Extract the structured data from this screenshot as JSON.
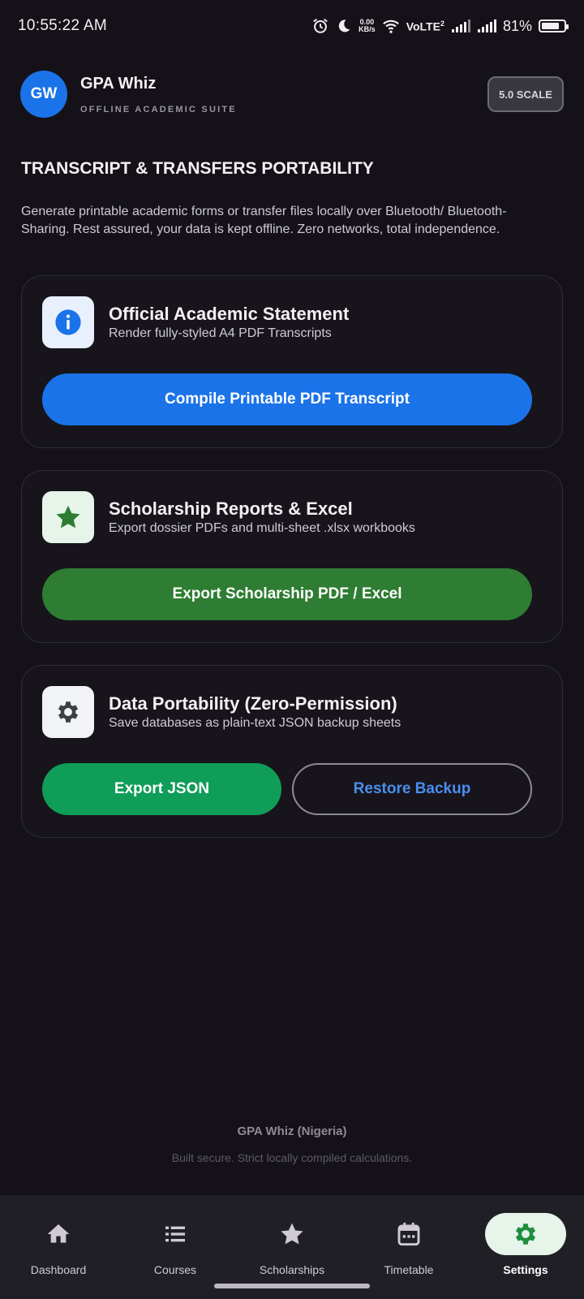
{
  "status_bar": {
    "time": "10:55:22 AM",
    "net_speed_value": "0.00",
    "net_speed_unit": "KB/s",
    "volte": "VoLTE",
    "volte_sup": "2",
    "battery_text": "81%",
    "battery_level": 0.81
  },
  "header": {
    "avatar_initials": "GW",
    "app_name": "GPA Whiz",
    "tagline": "OFFLINE ACADEMIC SUITE",
    "scale_chip": "5.0 SCALE"
  },
  "section": {
    "title": "TRANSCRIPT & TRANSFERS PORTABILITY",
    "description": "Generate printable academic forms or transfer files locally over Bluetooth/ Bluetooth-Sharing. Rest assured, your data is kept offline. Zero networks, total independence."
  },
  "cards": [
    {
      "title": "Official Academic Statement",
      "subtitle": "Render fully-styled A4 PDF Transcripts",
      "icon": "info-icon",
      "button": "Compile Printable PDF Transcript"
    },
    {
      "title": "Scholarship Reports & Excel",
      "subtitle": "Export dossier PDFs and multi-sheet .xlsx workbooks",
      "icon": "star-icon",
      "button": "Export Scholarship PDF / Excel"
    },
    {
      "title": "Data Portability (Zero-Permission)",
      "subtitle": "Save databases as plain-text JSON backup sheets",
      "icon": "gear-icon",
      "button_primary": "Export JSON",
      "button_secondary": "Restore Backup"
    }
  ],
  "footer": {
    "title": "GPA Whiz (Nigeria)",
    "subtitle": "Built secure. Strict locally compiled calculations."
  },
  "nav": [
    {
      "label": "Dashboard",
      "icon": "home-icon"
    },
    {
      "label": "Courses",
      "icon": "list-icon"
    },
    {
      "label": "Scholarships",
      "icon": "star-icon"
    },
    {
      "label": "Timetable",
      "icon": "calendar-icon"
    },
    {
      "label": "Settings",
      "icon": "gear-icon",
      "active": true
    }
  ],
  "colors": {
    "background": "#141218",
    "primary_blue": "#1A73E8",
    "scholarship_green": "#2E7D32",
    "json_green": "#0F9D58",
    "restore_text_blue": "#4A8EF0"
  }
}
